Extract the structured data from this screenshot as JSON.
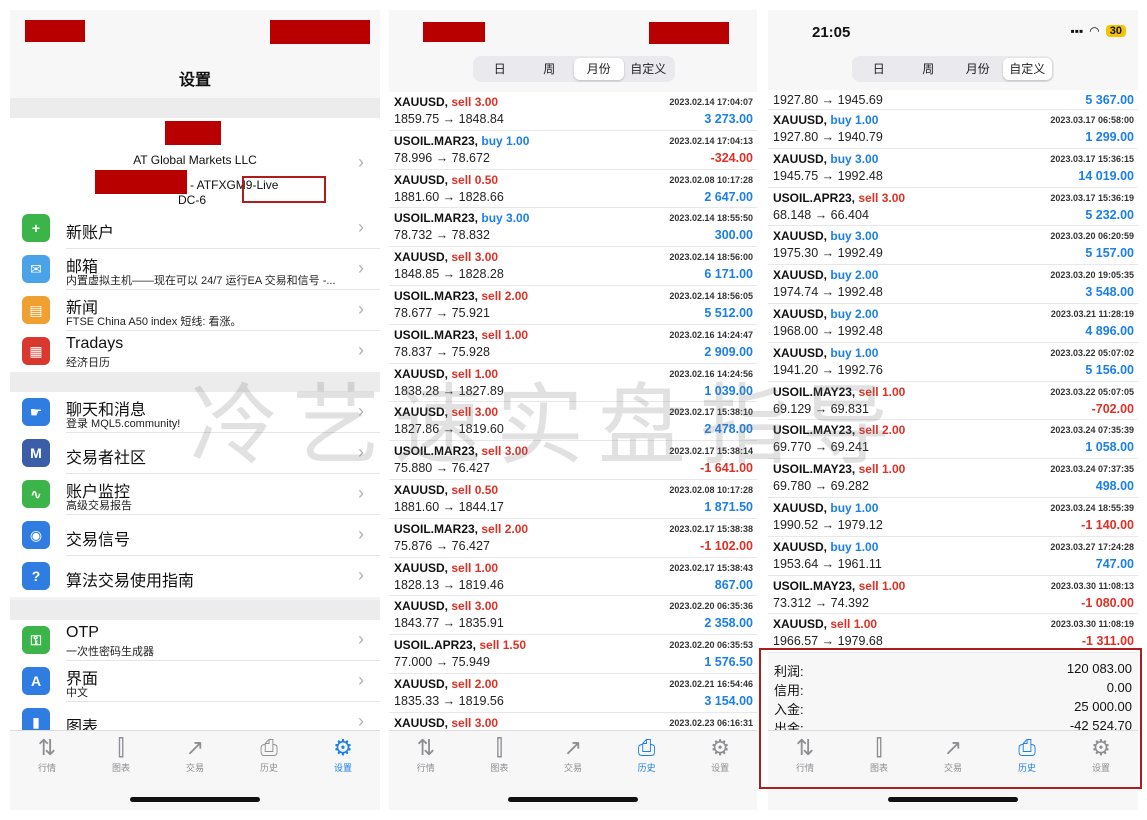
{
  "panel1": {
    "title": "设置",
    "account": {
      "company": "AT Global Markets LLC",
      "server_line": "- ATFXGM9-Live",
      "server_line2": "DC-6"
    },
    "group1": [
      {
        "title": "新账户",
        "sub": "",
        "icon": "add-user-icon",
        "color": "#3bb54a",
        "glyph": "+"
      },
      {
        "title": "邮箱",
        "sub": "内置虚拟主机——现在可以 24/7 运行EA 交易和信号 -...",
        "icon": "mail-icon",
        "color": "#4aa3e8",
        "glyph": "✉"
      },
      {
        "title": "新闻",
        "sub": "FTSE China A50 index 短线: 看涨。",
        "icon": "book-icon",
        "color": "#f0a030",
        "glyph": "▤"
      },
      {
        "title": "Tradays",
        "sub": "经济日历",
        "icon": "calendar-icon",
        "color": "#d9382e",
        "glyph": "▦"
      }
    ],
    "group2": [
      {
        "title": "聊天和消息",
        "sub": "登录 MQL5.community!",
        "icon": "chat-icon",
        "color": "#2f7de0",
        "glyph": "☛"
      },
      {
        "title": "交易者社区",
        "sub": "",
        "icon": "mql5-icon",
        "color": "#3a5fa8",
        "glyph": "M"
      },
      {
        "title": "账户监控",
        "sub": "高级交易报告",
        "icon": "monitor-icon",
        "color": "#3bb54a",
        "glyph": "∿"
      },
      {
        "title": "交易信号",
        "sub": "",
        "icon": "signal-icon",
        "color": "#2f7de0",
        "glyph": "◉"
      },
      {
        "title": "算法交易使用指南",
        "sub": "",
        "icon": "help-icon",
        "color": "#2f7de0",
        "glyph": "?"
      }
    ],
    "group3": [
      {
        "title": "OTP",
        "sub": "一次性密码生成器",
        "icon": "key-icon",
        "color": "#3bb54a",
        "glyph": "⚿"
      },
      {
        "title": "界面",
        "sub": "中文",
        "icon": "language-icon",
        "color": "#2f7de0",
        "glyph": "A"
      },
      {
        "title": "图表",
        "sub": "",
        "icon": "chart-icon",
        "color": "#2f7de0",
        "glyph": "▮"
      }
    ],
    "active_tab": 4
  },
  "tabs": [
    {
      "label": "行情",
      "icon": "quotes-icon",
      "glyph": "⇅"
    },
    {
      "label": "图表",
      "icon": "candles-icon",
      "glyph": "⫿"
    },
    {
      "label": "交易",
      "icon": "trade-icon",
      "glyph": "↗"
    },
    {
      "label": "历史",
      "icon": "history-icon",
      "glyph": "⎙"
    },
    {
      "label": "设置",
      "icon": "gear-icon",
      "glyph": "⚙"
    }
  ],
  "segments": [
    "日",
    "周",
    "月份",
    "自定义"
  ],
  "panel2": {
    "selected_segment": 2,
    "active_tab": 3,
    "trades": [
      {
        "sym": "XAUUSD,",
        "dir": "sell 3.00",
        "side": "sell",
        "time": "2023.02.14 17:04:07",
        "price": "1859.75 → 1848.84",
        "pl": "3 273.00",
        "sign": "pos"
      },
      {
        "sym": "USOIL.MAR23,",
        "dir": "buy 1.00",
        "side": "buy",
        "time": "2023.02.14 17:04:13",
        "price": "78.996 → 78.672",
        "pl": "-324.00",
        "sign": "neg"
      },
      {
        "sym": "XAUUSD,",
        "dir": "sell 0.50",
        "side": "sell",
        "time": "2023.02.08 10:17:28",
        "price": "1881.60 → 1828.66",
        "pl": "2 647.00",
        "sign": "pos"
      },
      {
        "sym": "USOIL.MAR23,",
        "dir": "buy 3.00",
        "side": "buy",
        "time": "2023.02.14 18:55:50",
        "price": "78.732 → 78.832",
        "pl": "300.00",
        "sign": "pos"
      },
      {
        "sym": "XAUUSD,",
        "dir": "sell 3.00",
        "side": "sell",
        "time": "2023.02.14 18:56:00",
        "price": "1848.85 → 1828.28",
        "pl": "6 171.00",
        "sign": "pos"
      },
      {
        "sym": "USOIL.MAR23,",
        "dir": "sell 2.00",
        "side": "sell",
        "time": "2023.02.14 18:56:05",
        "price": "78.677 → 75.921",
        "pl": "5 512.00",
        "sign": "pos"
      },
      {
        "sym": "USOIL.MAR23,",
        "dir": "sell 1.00",
        "side": "sell",
        "time": "2023.02.16 14:24:47",
        "price": "78.837 → 75.928",
        "pl": "2 909.00",
        "sign": "pos"
      },
      {
        "sym": "XAUUSD,",
        "dir": "sell 1.00",
        "side": "sell",
        "time": "2023.02.16 14:24:56",
        "price": "1838.28 → 1827.89",
        "pl": "1 039.00",
        "sign": "pos"
      },
      {
        "sym": "XAUUSD,",
        "dir": "sell 3.00",
        "side": "sell",
        "time": "2023.02.17 15:38:10",
        "price": "1827.86 → 1819.60",
        "pl": "2 478.00",
        "sign": "pos"
      },
      {
        "sym": "USOIL.MAR23,",
        "dir": "sell 3.00",
        "side": "sell",
        "time": "2023.02.17 15:38:14",
        "price": "75.880 → 76.427",
        "pl": "-1 641.00",
        "sign": "neg"
      },
      {
        "sym": "XAUUSD,",
        "dir": "sell 0.50",
        "side": "sell",
        "time": "2023.02.08 10:17:28",
        "price": "1881.60 → 1844.17",
        "pl": "1 871.50",
        "sign": "pos"
      },
      {
        "sym": "USOIL.MAR23,",
        "dir": "sell 2.00",
        "side": "sell",
        "time": "2023.02.17 15:38:38",
        "price": "75.876 → 76.427",
        "pl": "-1 102.00",
        "sign": "neg"
      },
      {
        "sym": "XAUUSD,",
        "dir": "sell 1.00",
        "side": "sell",
        "time": "2023.02.17 15:38:43",
        "price": "1828.13 → 1819.46",
        "pl": "867.00",
        "sign": "pos"
      },
      {
        "sym": "XAUUSD,",
        "dir": "sell 3.00",
        "side": "sell",
        "time": "2023.02.20 06:35:36",
        "price": "1843.77 → 1835.91",
        "pl": "2 358.00",
        "sign": "pos"
      },
      {
        "sym": "USOIL.APR23,",
        "dir": "sell 1.50",
        "side": "sell",
        "time": "2023.02.20 06:35:53",
        "price": "77.000 → 75.949",
        "pl": "1 576.50",
        "sign": "pos"
      },
      {
        "sym": "XAUUSD,",
        "dir": "sell 2.00",
        "side": "sell",
        "time": "2023.02.21 16:54:46",
        "price": "1835.33 → 1819.56",
        "pl": "3 154.00",
        "sign": "pos"
      },
      {
        "sym": "XAUUSD,",
        "dir": "sell 3.00",
        "side": "sell",
        "time": "2023.02.23 06:16:31",
        "price": "",
        "pl": "",
        "sign": "pos"
      }
    ]
  },
  "panel3": {
    "status_time": "21:05",
    "battery": "30",
    "selected_segment": 3,
    "active_tab": 3,
    "first_price": "1927.80 → 1945.69",
    "first_pl": "5 367.00",
    "trades": [
      {
        "sym": "XAUUSD,",
        "dir": "buy 1.00",
        "side": "buy",
        "time": "2023.03.17 06:58:00",
        "price": "1927.80 → 1940.79",
        "pl": "1 299.00",
        "sign": "pos"
      },
      {
        "sym": "XAUUSD,",
        "dir": "buy 3.00",
        "side": "buy",
        "time": "2023.03.17 15:36:15",
        "price": "1945.75 → 1992.48",
        "pl": "14 019.00",
        "sign": "pos"
      },
      {
        "sym": "USOIL.APR23,",
        "dir": "sell 3.00",
        "side": "sell",
        "time": "2023.03.17 15:36:19",
        "price": "68.148 → 66.404",
        "pl": "5 232.00",
        "sign": "pos"
      },
      {
        "sym": "XAUUSD,",
        "dir": "buy 3.00",
        "side": "buy",
        "time": "2023.03.20 06:20:59",
        "price": "1975.30 → 1992.49",
        "pl": "5 157.00",
        "sign": "pos"
      },
      {
        "sym": "XAUUSD,",
        "dir": "buy 2.00",
        "side": "buy",
        "time": "2023.03.20 19:05:35",
        "price": "1974.74 → 1992.48",
        "pl": "3 548.00",
        "sign": "pos"
      },
      {
        "sym": "XAUUSD,",
        "dir": "buy 2.00",
        "side": "buy",
        "time": "2023.03.21 11:28:19",
        "price": "1968.00 → 1992.48",
        "pl": "4 896.00",
        "sign": "pos"
      },
      {
        "sym": "XAUUSD,",
        "dir": "buy 1.00",
        "side": "buy",
        "time": "2023.03.22 05:07:02",
        "price": "1941.20 → 1992.76",
        "pl": "5 156.00",
        "sign": "pos"
      },
      {
        "sym": "USOIL.MAY23,",
        "dir": "sell 1.00",
        "side": "sell",
        "time": "2023.03.22 05:07:05",
        "price": "69.129 → 69.831",
        "pl": "-702.00",
        "sign": "neg"
      },
      {
        "sym": "USOIL.MAY23,",
        "dir": "sell 2.00",
        "side": "sell",
        "time": "2023.03.24 07:35:39",
        "price": "69.770 → 69.241",
        "pl": "1 058.00",
        "sign": "pos"
      },
      {
        "sym": "USOIL.MAY23,",
        "dir": "sell 1.00",
        "side": "sell",
        "time": "2023.03.24 07:37:35",
        "price": "69.780 → 69.282",
        "pl": "498.00",
        "sign": "pos"
      },
      {
        "sym": "XAUUSD,",
        "dir": "buy 1.00",
        "side": "buy",
        "time": "2023.03.24 18:55:39",
        "price": "1990.52 → 1979.12",
        "pl": "-1 140.00",
        "sign": "neg"
      },
      {
        "sym": "XAUUSD,",
        "dir": "buy 1.00",
        "side": "buy",
        "time": "2023.03.27 17:24:28",
        "price": "1953.64 → 1961.11",
        "pl": "747.00",
        "sign": "pos"
      },
      {
        "sym": "USOIL.MAY23,",
        "dir": "sell 1.00",
        "side": "sell",
        "time": "2023.03.30 11:08:13",
        "price": "73.312 → 74.392",
        "pl": "-1 080.00",
        "sign": "neg"
      },
      {
        "sym": "XAUUSD,",
        "dir": "sell 1.00",
        "side": "sell",
        "time": "2023.03.30 11:08:19",
        "price": "1966.57 → 1979.68",
        "pl": "-1 311.00",
        "sign": "neg"
      }
    ],
    "summary": [
      {
        "label": "利润:",
        "value": "120 083.00"
      },
      {
        "label": "信用:",
        "value": "0.00"
      },
      {
        "label": "入金:",
        "value": "25 000.00"
      },
      {
        "label": "出金:",
        "value": "-42 524.70"
      }
    ]
  },
  "watermark": "冷艺速实盘指导",
  "colors": {
    "accent": "#1a7fe8",
    "loss": "#e03025",
    "redaction": "#b90000",
    "highlight_box": "#b01c1c"
  }
}
